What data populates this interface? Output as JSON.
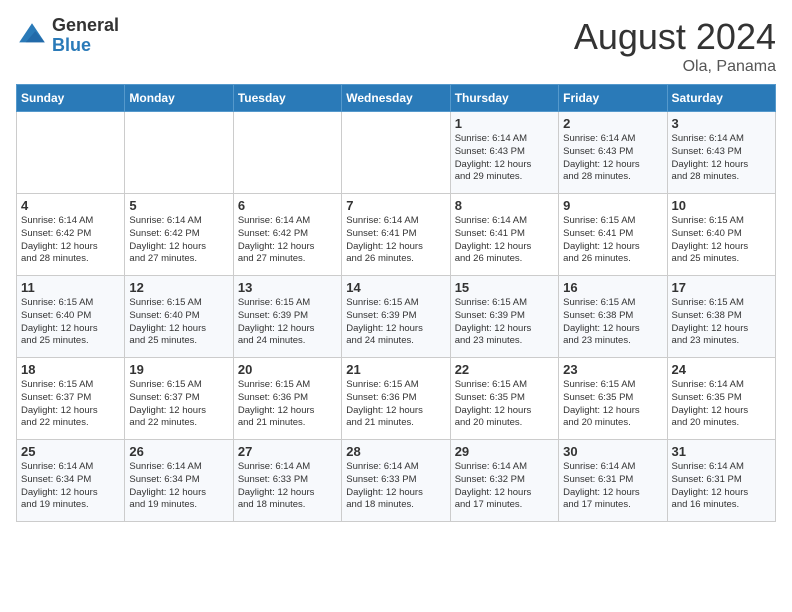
{
  "header": {
    "logo_general": "General",
    "logo_blue": "Blue",
    "month_title": "August 2024",
    "subtitle": "Ola, Panama"
  },
  "weekdays": [
    "Sunday",
    "Monday",
    "Tuesday",
    "Wednesday",
    "Thursday",
    "Friday",
    "Saturday"
  ],
  "weeks": [
    [
      {
        "day": "",
        "info": ""
      },
      {
        "day": "",
        "info": ""
      },
      {
        "day": "",
        "info": ""
      },
      {
        "day": "",
        "info": ""
      },
      {
        "day": "1",
        "info": "Sunrise: 6:14 AM\nSunset: 6:43 PM\nDaylight: 12 hours\nand 29 minutes."
      },
      {
        "day": "2",
        "info": "Sunrise: 6:14 AM\nSunset: 6:43 PM\nDaylight: 12 hours\nand 28 minutes."
      },
      {
        "day": "3",
        "info": "Sunrise: 6:14 AM\nSunset: 6:43 PM\nDaylight: 12 hours\nand 28 minutes."
      }
    ],
    [
      {
        "day": "4",
        "info": "Sunrise: 6:14 AM\nSunset: 6:42 PM\nDaylight: 12 hours\nand 28 minutes."
      },
      {
        "day": "5",
        "info": "Sunrise: 6:14 AM\nSunset: 6:42 PM\nDaylight: 12 hours\nand 27 minutes."
      },
      {
        "day": "6",
        "info": "Sunrise: 6:14 AM\nSunset: 6:42 PM\nDaylight: 12 hours\nand 27 minutes."
      },
      {
        "day": "7",
        "info": "Sunrise: 6:14 AM\nSunset: 6:41 PM\nDaylight: 12 hours\nand 26 minutes."
      },
      {
        "day": "8",
        "info": "Sunrise: 6:14 AM\nSunset: 6:41 PM\nDaylight: 12 hours\nand 26 minutes."
      },
      {
        "day": "9",
        "info": "Sunrise: 6:15 AM\nSunset: 6:41 PM\nDaylight: 12 hours\nand 26 minutes."
      },
      {
        "day": "10",
        "info": "Sunrise: 6:15 AM\nSunset: 6:40 PM\nDaylight: 12 hours\nand 25 minutes."
      }
    ],
    [
      {
        "day": "11",
        "info": "Sunrise: 6:15 AM\nSunset: 6:40 PM\nDaylight: 12 hours\nand 25 minutes."
      },
      {
        "day": "12",
        "info": "Sunrise: 6:15 AM\nSunset: 6:40 PM\nDaylight: 12 hours\nand 25 minutes."
      },
      {
        "day": "13",
        "info": "Sunrise: 6:15 AM\nSunset: 6:39 PM\nDaylight: 12 hours\nand 24 minutes."
      },
      {
        "day": "14",
        "info": "Sunrise: 6:15 AM\nSunset: 6:39 PM\nDaylight: 12 hours\nand 24 minutes."
      },
      {
        "day": "15",
        "info": "Sunrise: 6:15 AM\nSunset: 6:39 PM\nDaylight: 12 hours\nand 23 minutes."
      },
      {
        "day": "16",
        "info": "Sunrise: 6:15 AM\nSunset: 6:38 PM\nDaylight: 12 hours\nand 23 minutes."
      },
      {
        "day": "17",
        "info": "Sunrise: 6:15 AM\nSunset: 6:38 PM\nDaylight: 12 hours\nand 23 minutes."
      }
    ],
    [
      {
        "day": "18",
        "info": "Sunrise: 6:15 AM\nSunset: 6:37 PM\nDaylight: 12 hours\nand 22 minutes."
      },
      {
        "day": "19",
        "info": "Sunrise: 6:15 AM\nSunset: 6:37 PM\nDaylight: 12 hours\nand 22 minutes."
      },
      {
        "day": "20",
        "info": "Sunrise: 6:15 AM\nSunset: 6:36 PM\nDaylight: 12 hours\nand 21 minutes."
      },
      {
        "day": "21",
        "info": "Sunrise: 6:15 AM\nSunset: 6:36 PM\nDaylight: 12 hours\nand 21 minutes."
      },
      {
        "day": "22",
        "info": "Sunrise: 6:15 AM\nSunset: 6:35 PM\nDaylight: 12 hours\nand 20 minutes."
      },
      {
        "day": "23",
        "info": "Sunrise: 6:15 AM\nSunset: 6:35 PM\nDaylight: 12 hours\nand 20 minutes."
      },
      {
        "day": "24",
        "info": "Sunrise: 6:14 AM\nSunset: 6:35 PM\nDaylight: 12 hours\nand 20 minutes."
      }
    ],
    [
      {
        "day": "25",
        "info": "Sunrise: 6:14 AM\nSunset: 6:34 PM\nDaylight: 12 hours\nand 19 minutes."
      },
      {
        "day": "26",
        "info": "Sunrise: 6:14 AM\nSunset: 6:34 PM\nDaylight: 12 hours\nand 19 minutes."
      },
      {
        "day": "27",
        "info": "Sunrise: 6:14 AM\nSunset: 6:33 PM\nDaylight: 12 hours\nand 18 minutes."
      },
      {
        "day": "28",
        "info": "Sunrise: 6:14 AM\nSunset: 6:33 PM\nDaylight: 12 hours\nand 18 minutes."
      },
      {
        "day": "29",
        "info": "Sunrise: 6:14 AM\nSunset: 6:32 PM\nDaylight: 12 hours\nand 17 minutes."
      },
      {
        "day": "30",
        "info": "Sunrise: 6:14 AM\nSunset: 6:31 PM\nDaylight: 12 hours\nand 17 minutes."
      },
      {
        "day": "31",
        "info": "Sunrise: 6:14 AM\nSunset: 6:31 PM\nDaylight: 12 hours\nand 16 minutes."
      }
    ]
  ]
}
